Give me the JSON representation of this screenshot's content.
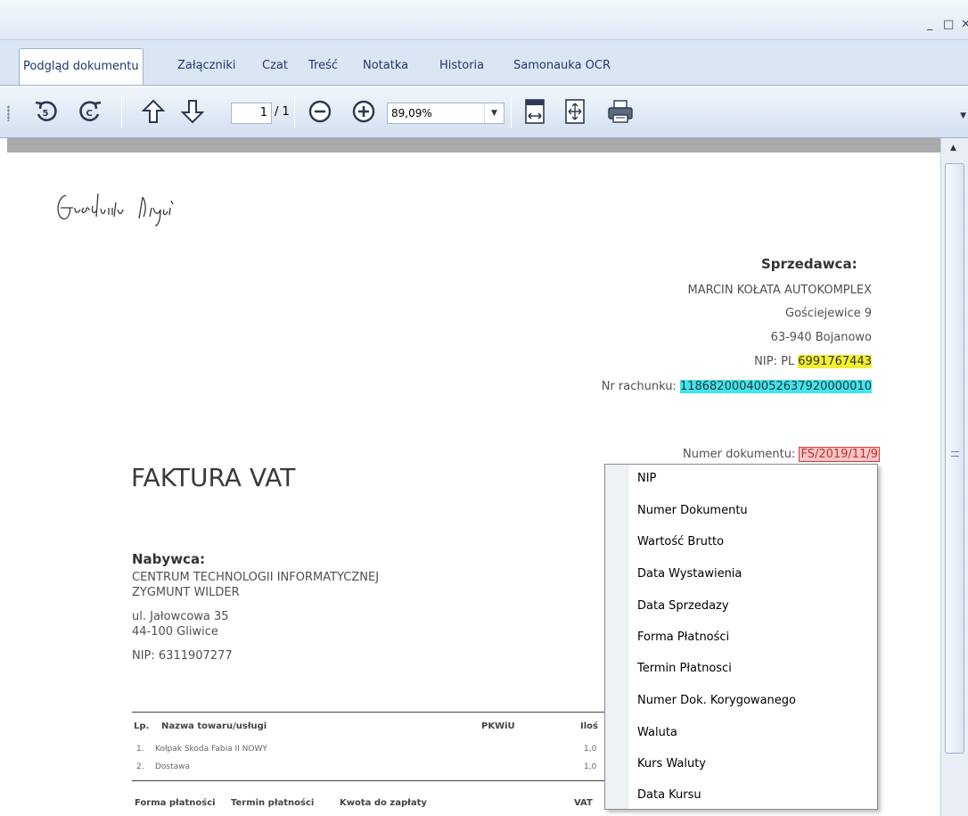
{
  "window": {
    "minimize_glyph": "_",
    "maximize_glyph": "□",
    "close_glyph": "✕"
  },
  "tabs": [
    {
      "label": "Podgląd dokumentu"
    },
    {
      "label": "Załączniki"
    },
    {
      "label": "Czat"
    },
    {
      "label": "Treść"
    },
    {
      "label": "Notatka"
    },
    {
      "label": "Historia"
    },
    {
      "label": "Samonauka OCR"
    }
  ],
  "toolbar": {
    "icons": [
      "rotate-left-icon",
      "rotate-right-icon",
      "arrow-up-icon",
      "arrow-down-icon",
      "zoom-out-icon",
      "zoom-in-icon",
      "fit-width-icon",
      "fit-page-icon",
      "print-icon"
    ],
    "page_current": "1",
    "page_total": "/ 1",
    "zoom_value": "89,09%"
  },
  "document": {
    "seller_heading": "Sprzedawca:",
    "seller_name": "MARCIN KOŁATA AUTOKOMPLEX",
    "seller_street": "Gościejewice 9",
    "seller_city": "63-940 Bojanowo",
    "seller_nip_label": "NIP: PL ",
    "seller_nip_value": "6991767443",
    "account_label": "Nr rachunku: ",
    "account_value": "11868200040052637920000010",
    "doc_number_label": "Numer dokumentu: ",
    "doc_number_value": "FS/2019/11/9",
    "title": "FAKTURA VAT",
    "buyer_heading": "Nabywca:",
    "buyer_line1": "CENTRUM TECHNOLOGII INFORMATYCZNEJ",
    "buyer_line2": "ZYGMUNT WILDER",
    "buyer_street": "ul. Jałowcowa 35",
    "buyer_city": "44-100 Gliwice",
    "buyer_nip": "NIP: 6311907277",
    "table": {
      "headers": {
        "lp": "Lp.",
        "name": "Nazwa towaru/usługi",
        "pkwiu": "PKWiU",
        "qty": "Iloś"
      },
      "rows": [
        {
          "lp": "1.",
          "name": "Kołpak Skoda Fabia II NOWY",
          "qty": "1,0"
        },
        {
          "lp": "2.",
          "name": "Dostawa",
          "qty": "1,0"
        }
      ],
      "footer": {
        "payment_form": "Forma płatności",
        "payment_term": "Termin płatności",
        "amount_due": "Kwota do zapłaty",
        "vat": "VAT"
      }
    }
  },
  "context_menu": {
    "items": [
      {
        "label": "NIP"
      },
      {
        "label": "Numer Dokumentu"
      },
      {
        "label": "Wartość Brutto"
      },
      {
        "label": "Data Wystawienia"
      },
      {
        "label": "Data Sprzedazy"
      },
      {
        "label": "Forma Płatności"
      },
      {
        "label": "Termin Płatnosci"
      },
      {
        "label": "Numer Dok. Korygowanego"
      },
      {
        "label": "Waluta"
      },
      {
        "label": "Kurs Waluty"
      },
      {
        "label": "Data Kursu"
      }
    ]
  }
}
